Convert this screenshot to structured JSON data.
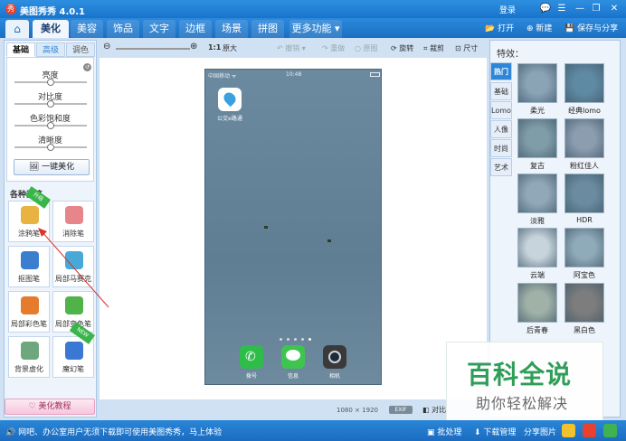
{
  "window": {
    "title": "美图秀秀 4.0.1",
    "login": "登录",
    "controls": [
      "💬",
      "☰",
      "—",
      "❐",
      "✕"
    ]
  },
  "menu": {
    "tabs": [
      "美化",
      "美容",
      "饰品",
      "文字",
      "边框",
      "场景",
      "拼图"
    ],
    "more": "更多功能",
    "right": {
      "open": "打开",
      "new": "新建",
      "save": "保存与分享"
    }
  },
  "toolbar": {
    "zoom_ratio": "1:1",
    "original_size": "原大",
    "undo": "撤销",
    "redo": "重做",
    "original": "原图",
    "rotate": "旋转",
    "crop": "裁剪",
    "resize": "尺寸"
  },
  "left": {
    "subtabs": [
      "基础",
      "高级",
      "调色"
    ],
    "sliders": [
      {
        "label": "亮度",
        "level": 0.5
      },
      {
        "label": "对比度",
        "level": 0.5
      },
      {
        "label": "色彩饱和度",
        "level": 0.5
      },
      {
        "label": "清晰度",
        "level": 0.5
      }
    ],
    "one_click": "一键美化",
    "brush_title": "各种画笔",
    "tools": [
      {
        "label": "涂鸦笔",
        "badge": "升级",
        "color": "#e9b341"
      },
      {
        "label": "消除笔",
        "badge": "",
        "color": "#e6868a"
      },
      {
        "label": "抠图笔",
        "badge": "",
        "color": "#3b7ed0"
      },
      {
        "label": "局部马赛克",
        "badge": "",
        "color": "#48a9d8"
      },
      {
        "label": "局部彩色笔",
        "badge": "",
        "color": "#e57c2d"
      },
      {
        "label": "局部变色笔",
        "badge": "",
        "color": "#4fb34a"
      },
      {
        "label": "背景虚化",
        "badge": "",
        "color": "#6ea77e"
      },
      {
        "label": "魔幻笔",
        "badge": "NEW",
        "color": "#3b78d4"
      }
    ],
    "tutorial": "美化教程"
  },
  "canvas": {
    "phone_status_left": "中国移动 ᯤ ",
    "phone_time": "10:48",
    "apps": [
      {
        "label": "公交e路通",
        "color": "#ffffff"
      }
    ],
    "dock": [
      {
        "label": "拨号",
        "color": "#2fbd4a"
      },
      {
        "label": "信息",
        "color": "#3dc54f"
      },
      {
        "label": "相机",
        "color": "#3a3a3a"
      }
    ],
    "width": "1080",
    "times": "×",
    "height": "1920",
    "exif": "EXIF",
    "compare": "对比"
  },
  "right": {
    "title": "特效：",
    "categories": [
      "热门",
      "基础",
      "Lomo",
      "人像",
      "时尚",
      "艺术"
    ],
    "effects": [
      {
        "label": "柔光",
        "color": "#8aa4b5"
      },
      {
        "label": "经典lomo",
        "color": "#5f8aa3"
      },
      {
        "label": "复古",
        "color": "#7f9da8"
      },
      {
        "label": "粉红佳人",
        "color": "#8c9db0"
      },
      {
        "label": "淡雅",
        "color": "#90a8b8"
      },
      {
        "label": "HDR",
        "color": "#6b8ca0"
      },
      {
        "label": "云端",
        "color": "#c7d4dc"
      },
      {
        "label": "阿宝色",
        "color": "#8faab8"
      },
      {
        "label": "后青春",
        "color": "#a0b2a8"
      },
      {
        "label": "黑白色",
        "color": "#7d7d7d"
      }
    ]
  },
  "watermark": {
    "main": "百科全说",
    "sub": "助你轻松解决"
  },
  "status": {
    "message": "🔊 网吧、办公室用户无须下载即可使用美图秀秀，马上体验",
    "batch": "批处理",
    "download": "下载管理",
    "share": "分享图片"
  }
}
